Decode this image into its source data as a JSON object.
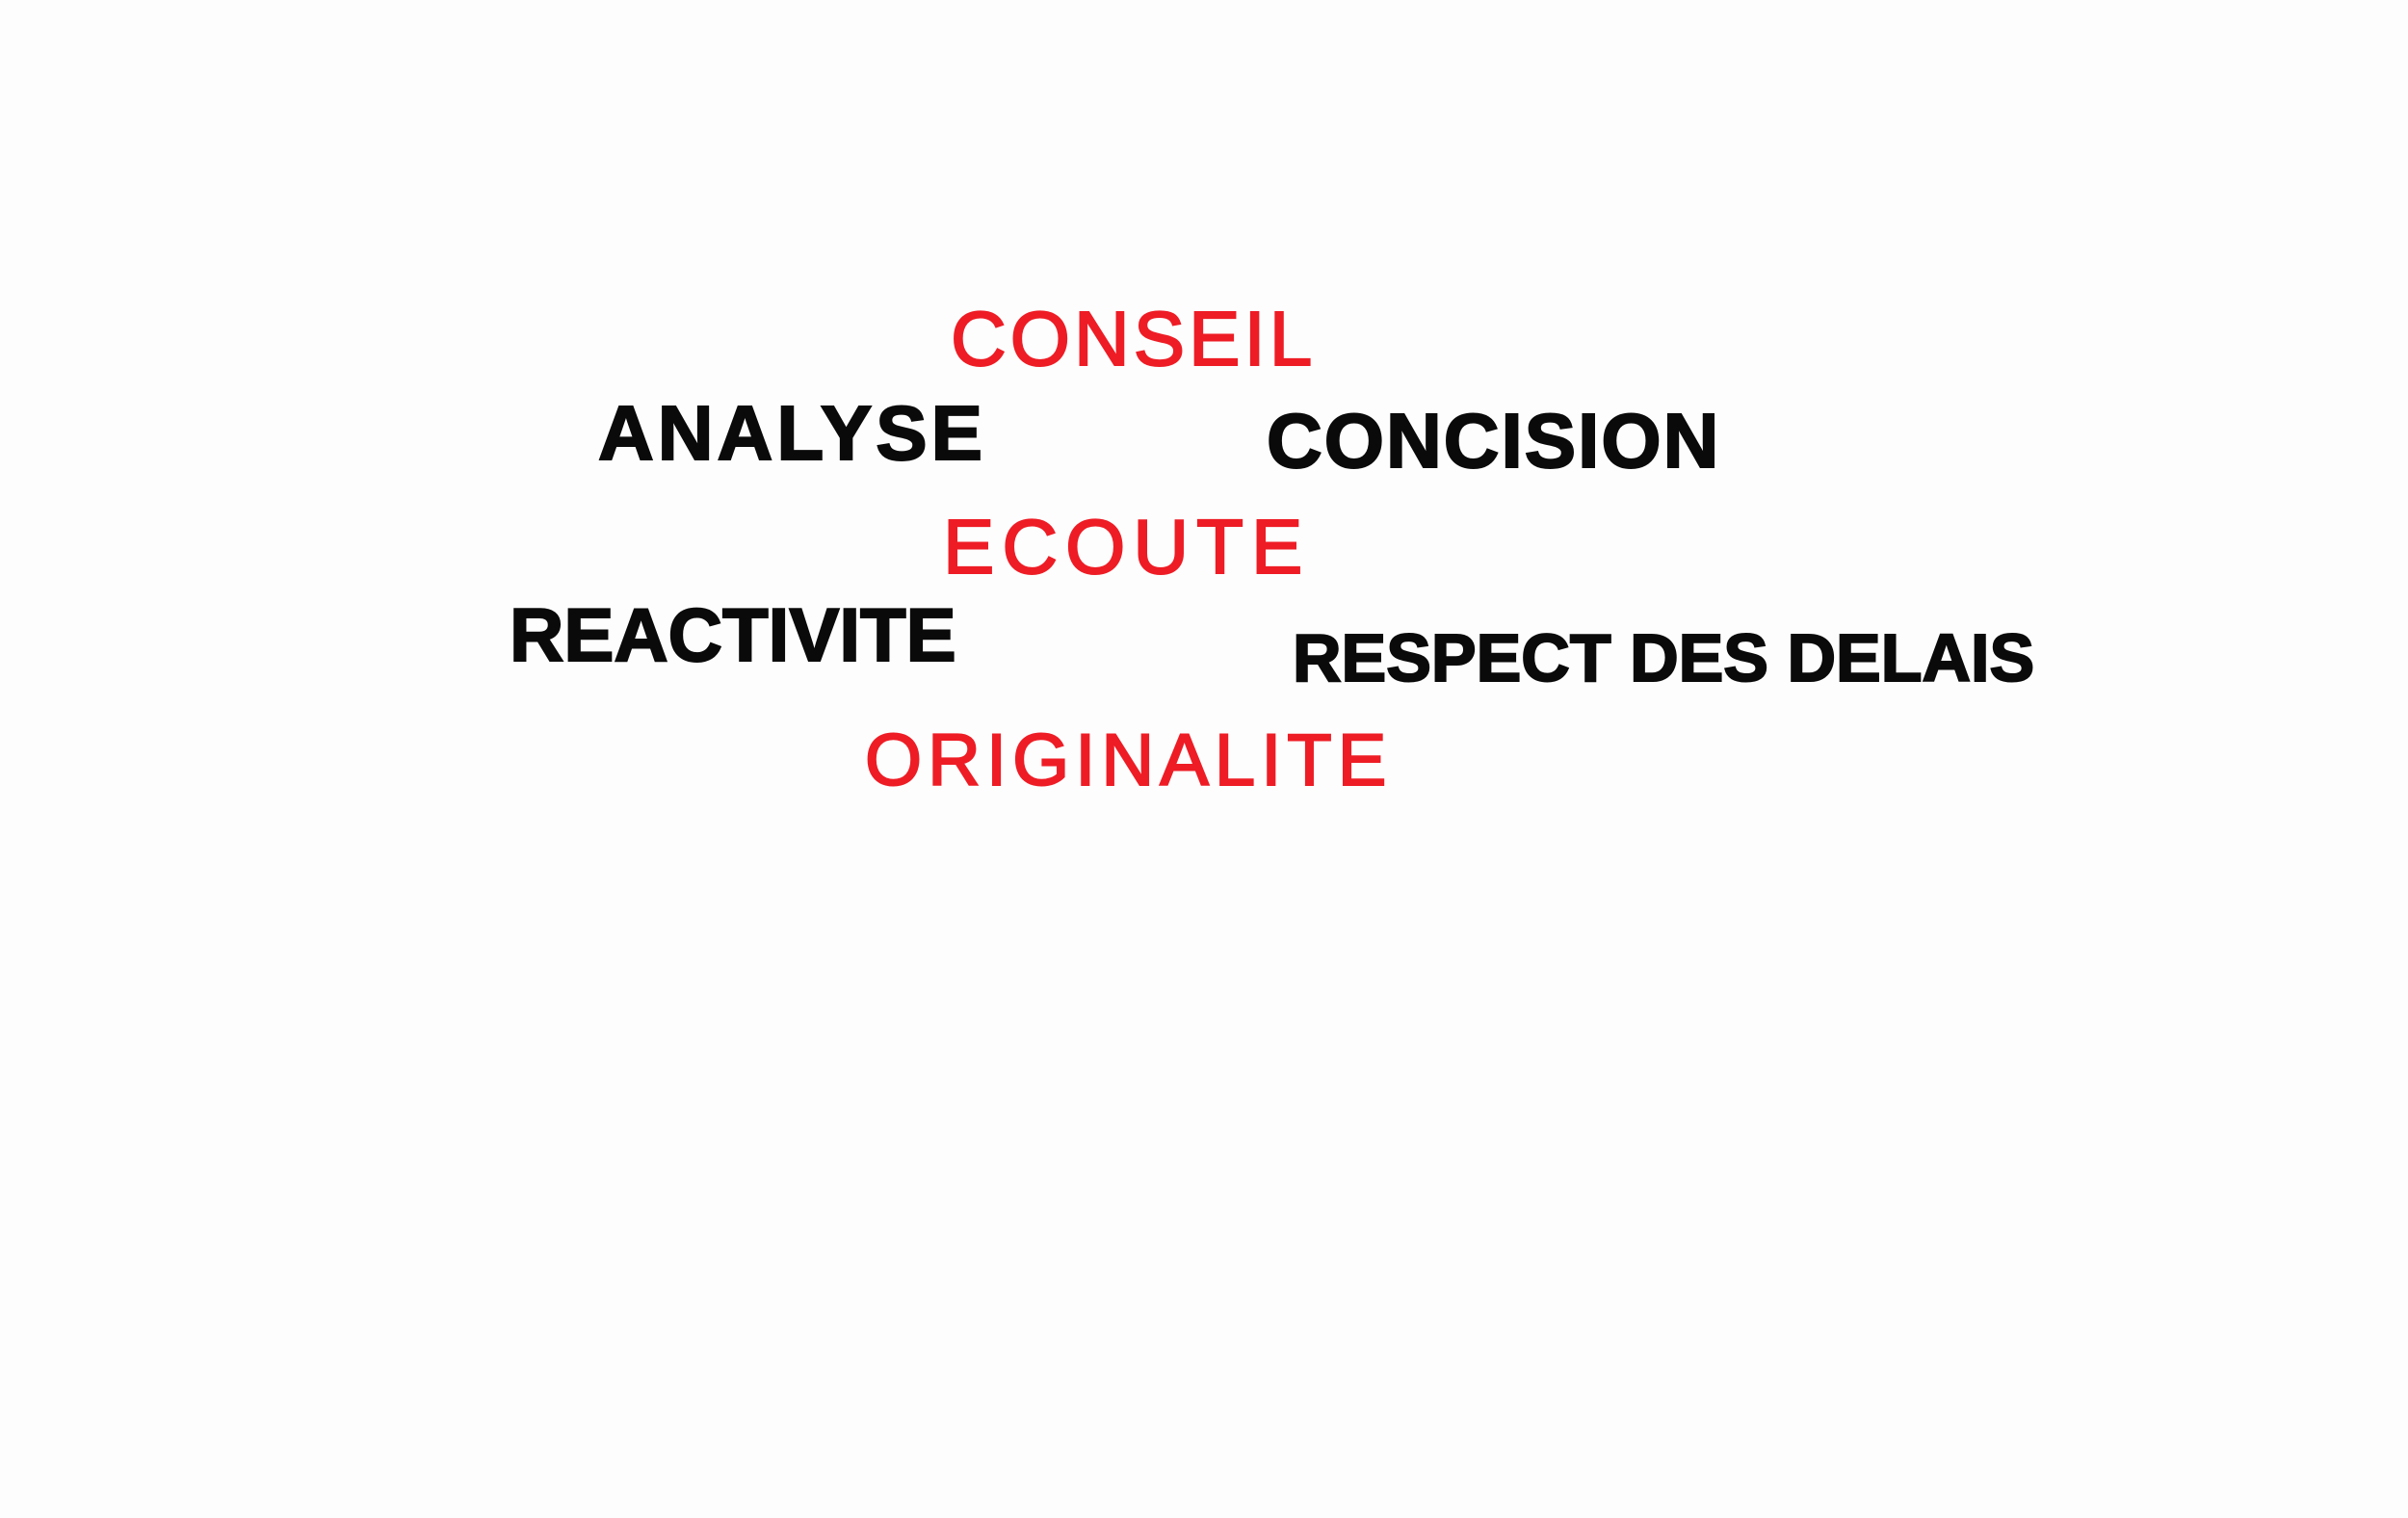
{
  "words": {
    "conseil": "Conseil",
    "analyse": "Analyse",
    "concision": "Concision",
    "ecoute": "Ecoute",
    "reactivite": "Reactivite",
    "respect_des_delais": "Respect des delais",
    "originalite": "Originalite"
  },
  "colors": {
    "red": "#ee1c25",
    "black": "#0a0a0a"
  }
}
